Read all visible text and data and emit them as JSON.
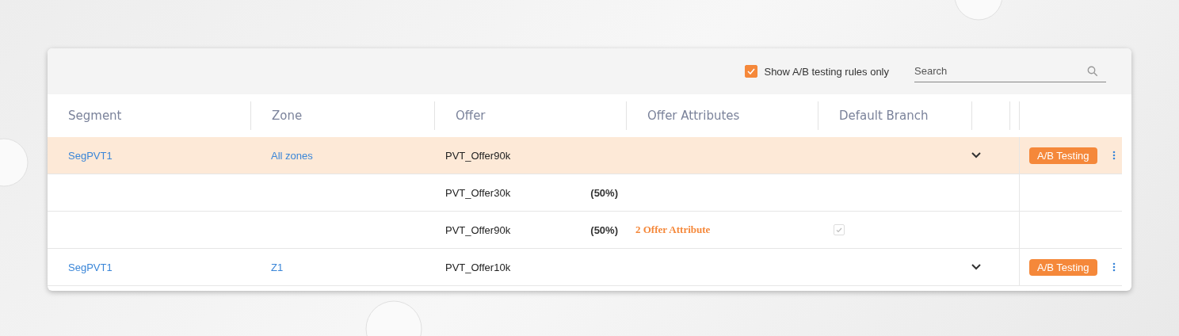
{
  "toolbar": {
    "filter": {
      "label": "Show A/B testing rules only",
      "checked": true
    },
    "search": {
      "placeholder": "Search"
    }
  },
  "table": {
    "columns": [
      "Segment",
      "Zone",
      "Offer",
      "Offer Attributes",
      "Default Branch"
    ],
    "rows": [
      {
        "kind": "rule",
        "selected": true,
        "segment": "SegPVT1",
        "zone": "All zones",
        "offer": "PVT_Offer90k",
        "badge": "A/B Testing"
      },
      {
        "kind": "variant",
        "offer": "PVT_Offer30k",
        "share": "(50%)"
      },
      {
        "kind": "variant",
        "offer": "PVT_Offer90k",
        "share": "(50%)",
        "attribute": "2 Offer Attribute",
        "default_branch": true
      },
      {
        "kind": "rule",
        "selected": false,
        "segment": "SegPVT1",
        "zone": "Z1",
        "offer": "PVT_Offer10k",
        "badge": "A/B Testing"
      }
    ]
  }
}
